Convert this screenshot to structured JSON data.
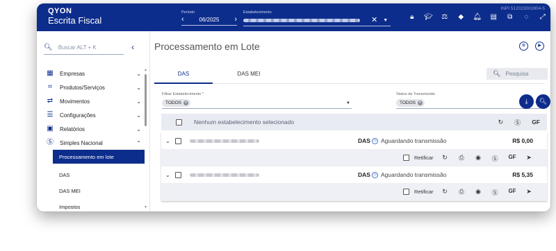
{
  "topbar": {
    "brand": "QYON",
    "app_name": "Escrita Fiscal",
    "inpi": "INPI 512023002804-5",
    "period_label": "Período",
    "period_value": "06/2025",
    "estab_label": "Estabelecimento",
    "icons": [
      "lock-icon",
      "graduation-cap-icon",
      "scale-icon",
      "cube-icon",
      "bell-icon",
      "document-icon",
      "external-link-icon",
      "chat-icon",
      "fullscreen-icon"
    ]
  },
  "sidebar": {
    "search_placeholder": "Buscar ALT + K",
    "items": [
      {
        "label": "Empresas",
        "icon": "building-icon"
      },
      {
        "label": "Produtos/Serviços",
        "icon": "products-icon"
      },
      {
        "label": "Movimentos",
        "icon": "arrows-icon"
      },
      {
        "label": "Configurações",
        "icon": "sliders-icon"
      },
      {
        "label": "Relatórios",
        "icon": "report-icon"
      },
      {
        "label": "Simples Nacional",
        "icon": "simples-icon"
      }
    ],
    "subitems": [
      "Processamento em lote",
      "DAS",
      "DAS MEI",
      "Impostos"
    ]
  },
  "main": {
    "title": "Processamento em Lote",
    "tabs": [
      "DAS",
      "DAS MEI"
    ],
    "search_placeholder": "Pesquisa",
    "filter_estab_label": "Filtrar Estabelecimento *",
    "filter_estab_chip": "TODOS",
    "filter_status_label": "Status da Transmissão",
    "filter_status_chip": "TODOS",
    "list_header": "Nenhum estabelecimento selecionado",
    "list_header_gf": "GF",
    "rows": [
      {
        "tax": "DAS",
        "status": "Aguardando transmissão",
        "value": "R$ 0,00",
        "retificar": "Retificar",
        "gf": "GF"
      },
      {
        "tax": "DAS",
        "status": "Aguardando transmissão",
        "value": "R$ 5,35",
        "retificar": "Retificar",
        "gf": "GF"
      }
    ]
  }
}
